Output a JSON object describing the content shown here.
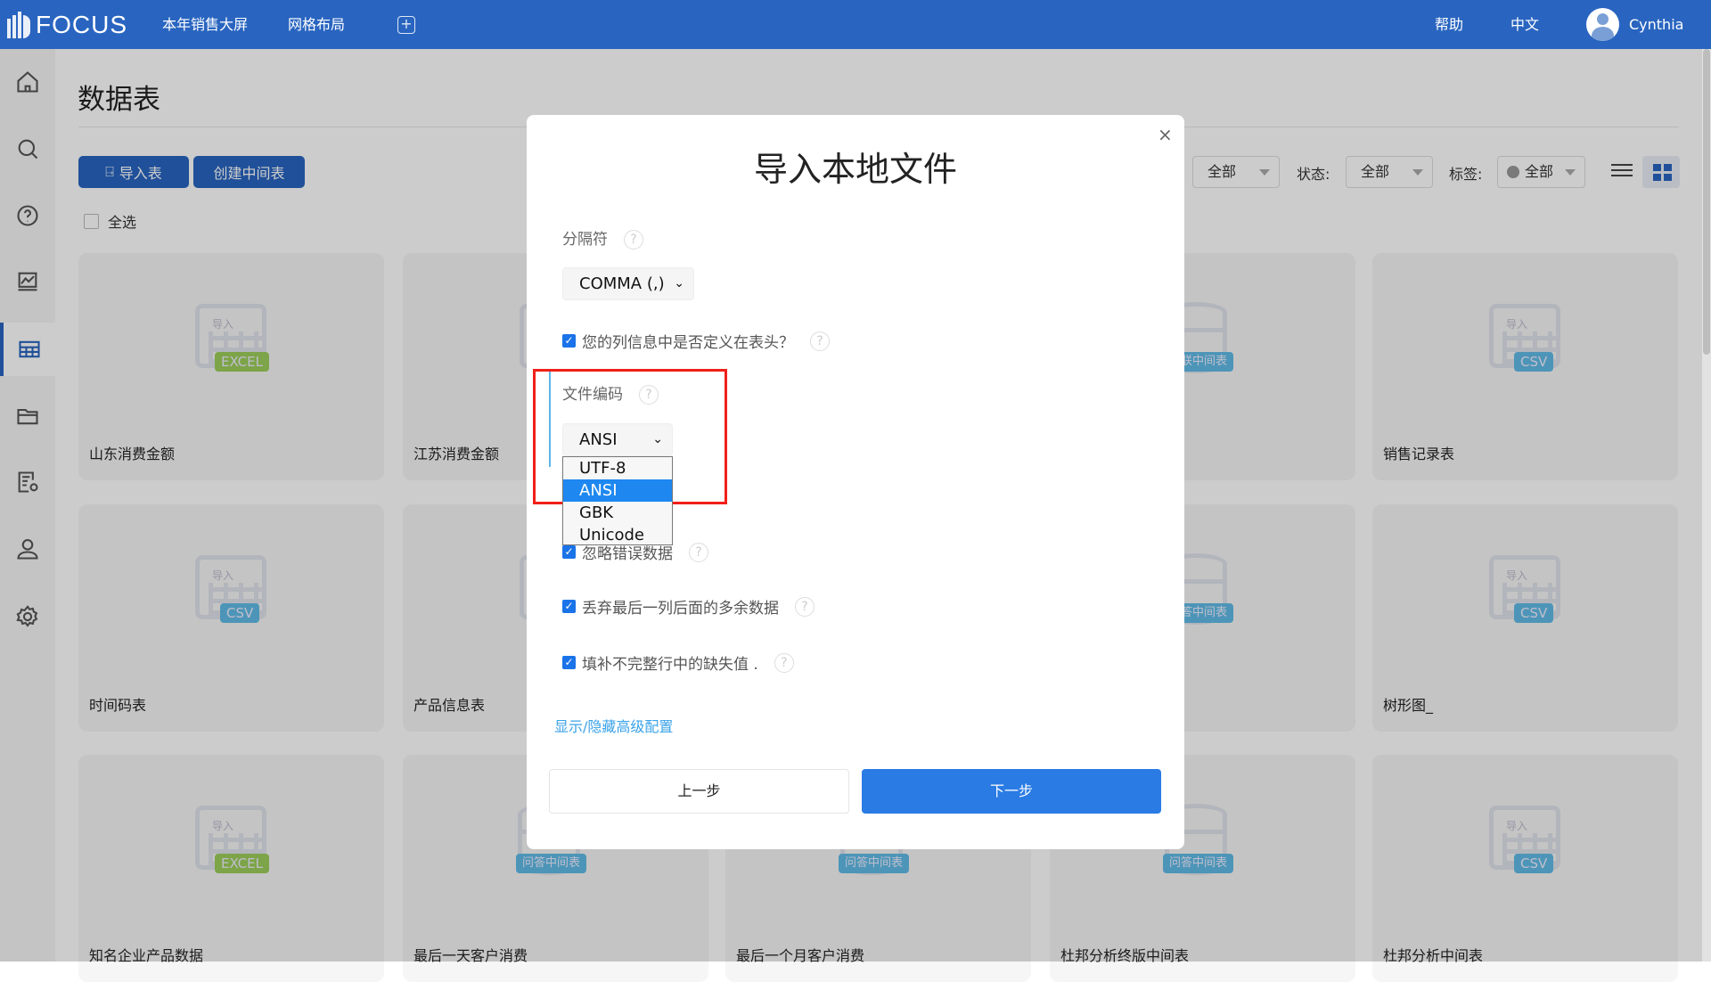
{
  "topbar": {
    "brand": "FOCUS",
    "nav": [
      "本年销售大屏",
      "网格布局"
    ],
    "add_label": "+",
    "help": "帮助",
    "language": "中文",
    "user": "Cynthia",
    "color": "#2965c0"
  },
  "sidebar": {
    "items": [
      {
        "icon": "home-icon"
      },
      {
        "icon": "search-icon"
      },
      {
        "icon": "question-icon"
      },
      {
        "icon": "presentation-chart-icon"
      },
      {
        "icon": "table-icon",
        "active": true
      },
      {
        "icon": "folder-icon"
      },
      {
        "icon": "report-settings-icon"
      },
      {
        "icon": "user-icon"
      },
      {
        "icon": "settings-gear-icon"
      }
    ]
  },
  "page": {
    "title": "数据表",
    "import_button": "导入表",
    "create_button": "创建中间表",
    "select_all": "全选",
    "filters": {
      "type_value": "全部",
      "status_label": "状态:",
      "status_value": "全部",
      "tag_label": "标签:",
      "tag_value": "全部"
    }
  },
  "cards": [
    {
      "name": "山东消费金额",
      "kind": "doc",
      "badge": "EXCEL",
      "badge_type": "excel"
    },
    {
      "name": "江苏消费金额",
      "kind": "doc",
      "badge": "",
      "badge_type": ""
    },
    {
      "name": "",
      "kind": "doc",
      "badge": "",
      "badge_type": ""
    },
    {
      "name": "",
      "kind": "db",
      "badge": "关联中间表",
      "badge_type": "db"
    },
    {
      "name": "销售记录表",
      "kind": "doc",
      "badge": "CSV",
      "badge_type": "csv"
    },
    {
      "name": "时间码表",
      "kind": "doc",
      "badge": "CSV",
      "badge_type": "csv"
    },
    {
      "name": "产品信息表",
      "kind": "doc",
      "badge": "",
      "badge_type": ""
    },
    {
      "name": "",
      "kind": "doc",
      "badge": "",
      "badge_type": ""
    },
    {
      "name": "",
      "kind": "db",
      "badge": "问答中间表",
      "badge_type": "db"
    },
    {
      "name": "树形图_",
      "kind": "doc",
      "badge": "CSV",
      "badge_type": "csv"
    },
    {
      "name": "知名企业产品数据",
      "kind": "doc",
      "badge": "EXCEL",
      "badge_type": "excel"
    },
    {
      "name": "最后一天客户消费",
      "kind": "db",
      "badge": "问答中间表",
      "badge_type": "db"
    },
    {
      "name": "最后一个月客户消费",
      "kind": "db",
      "badge": "问答中间表",
      "badge_type": "db"
    },
    {
      "name": "杜邦分析终版中间表",
      "kind": "db",
      "badge": "问答中间表",
      "badge_type": "db"
    },
    {
      "name": "杜邦分析中间表",
      "kind": "doc",
      "badge": "CSV",
      "badge_type": "csv"
    }
  ],
  "card_icon_label": "导入",
  "modal": {
    "title": "导入本地文件",
    "close": "×",
    "delimiter_label": "分隔符",
    "delimiter_value": "COMMA (,)",
    "header_checkbox": "您的列信息中是否定义在表头？",
    "encoding_label": "文件编码",
    "encoding_value": "ANSI",
    "encoding_options": [
      "UTF-8",
      "ANSI",
      "GBK",
      "Unicode"
    ],
    "encoding_selected_index": 1,
    "ignore_errors": "忽略错误数据",
    "discard_extra": "丢弃最后一列后面的多余数据",
    "fill_missing": "填补不完整行中的缺失值 .",
    "advanced_link": "显示/隐藏高级配置",
    "prev_button": "上一步",
    "next_button": "下一步",
    "help_glyph": "?",
    "check_glyph": "✓",
    "chevron_glyph": "⌄"
  }
}
